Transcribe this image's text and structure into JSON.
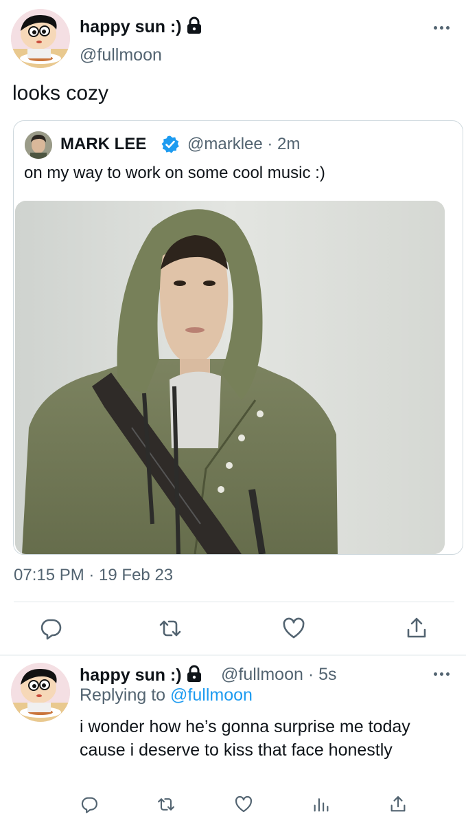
{
  "main_tweet": {
    "display_name": "happy sun :)",
    "handle": "@fullmoon",
    "text": "looks cozy",
    "timestamp": "07:15 PM · 19 Feb 23"
  },
  "quoted_tweet": {
    "display_name": "MARK LEE",
    "handle_time": "@marklee · 2m",
    "text": "on my way to work on some cool music :)"
  },
  "reply_tweet": {
    "display_name": "happy sun :)",
    "handle_time": "@fullmoon · 5s",
    "replying_prefix": "Replying to",
    "replying_handle": "@fullmoon",
    "text": "i wonder how he’s gonna surprise me today cause i deserve to kiss that face honestly"
  },
  "colors": {
    "text_primary": "#0f1419",
    "text_secondary": "#536471",
    "link": "#1d9bf0",
    "verified_badge": "#1d9bf0",
    "border": "#cfd9de"
  },
  "icons": [
    "lock-icon",
    "more-icon",
    "verified-badge-icon",
    "reply-icon",
    "retweet-icon",
    "like-icon",
    "views-icon",
    "share-icon"
  ]
}
